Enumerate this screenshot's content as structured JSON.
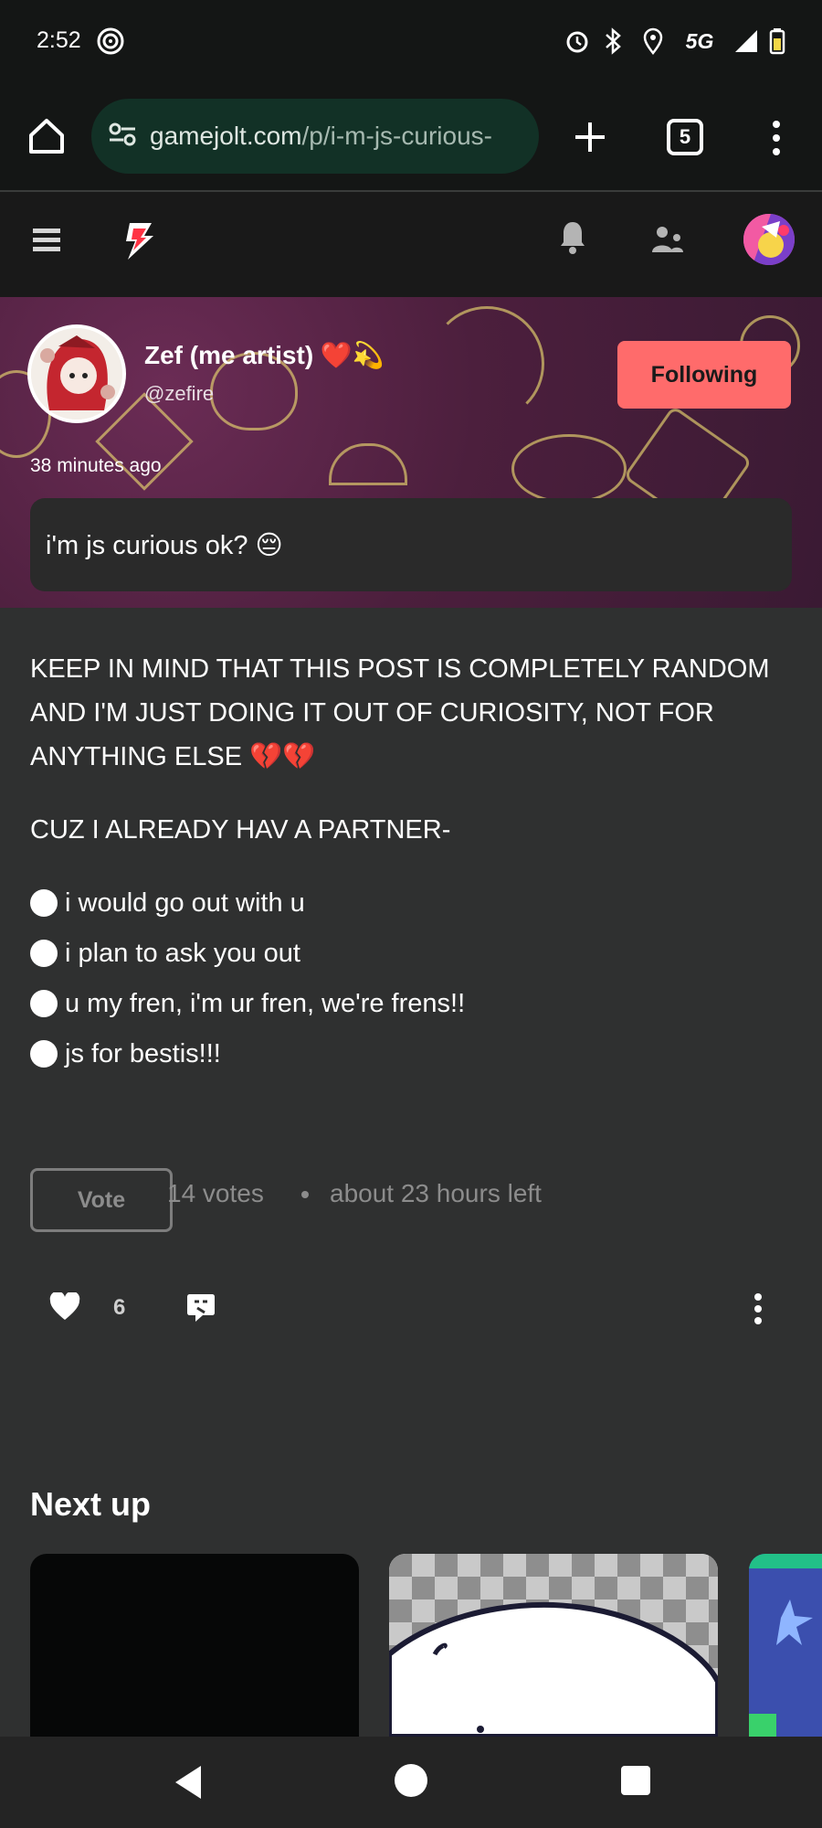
{
  "status_bar": {
    "time": "2:52",
    "icons": [
      "hotspot-icon",
      "alarm-icon",
      "bluetooth-icon",
      "location-icon",
      "5g-icon",
      "signal-icon",
      "battery-icon"
    ],
    "network": "5G"
  },
  "browser": {
    "url_domain": "gamejolt.com",
    "url_path": "/p/i-m-js-curious-",
    "tab_count": "5"
  },
  "post": {
    "author_name": "Zef (me artist) ❤️💫",
    "author_handle": "@zefire",
    "follow_label": "Following",
    "time_ago": "38 minutes ago",
    "lead": "i'm js curious ok? 😔",
    "paragraph1": "KEEP IN MIND THAT THIS POST IS COMPLETELY RANDOM AND I'M JUST DOING IT OUT OF CURIOSITY, NOT FOR ANYTHING ELSE 💔💔",
    "paragraph2": "CUZ I ALREADY HAV A PARTNER-",
    "poll": {
      "options": [
        "i would go out with u",
        "i plan to ask you out",
        "u my fren, i'm ur fren, we're frens!!",
        "js for bestis!!!"
      ],
      "vote_label": "Vote",
      "votes": "14 votes",
      "time_left": "about 23 hours left"
    },
    "like_count": "6"
  },
  "next_up": {
    "heading": "Next up"
  },
  "colors": {
    "accent_follow": "#ff6b6b",
    "background": "#2f3030",
    "chrome": "#141615",
    "url_box": "#123126"
  }
}
